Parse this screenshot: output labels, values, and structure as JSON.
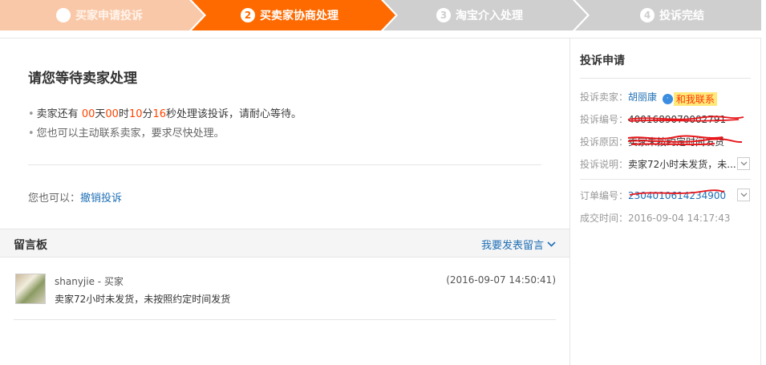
{
  "steps": [
    {
      "num": "",
      "label": "买家申请投诉",
      "state": "done"
    },
    {
      "num": "2",
      "label": "买卖家协商处理",
      "state": "active"
    },
    {
      "num": "3",
      "label": "淘宝介入处理",
      "state": "pending"
    },
    {
      "num": "4",
      "label": "投诉完结",
      "state": "pending"
    }
  ],
  "main": {
    "title": "请您等待卖家处理",
    "countdown": {
      "prefix": "卖家还有 ",
      "days": "00",
      "days_unit": "天",
      "hours": "00",
      "hours_unit": "时",
      "minutes": "10",
      "minutes_unit": "分",
      "seconds": "16",
      "seconds_unit": "秒处理该投诉，请耐心等待。"
    },
    "hint": "您也可以主动联系卖家，要求尽快处理。",
    "also_label": "您也可以：",
    "cancel_link": "撤销投诉"
  },
  "board": {
    "title": "留言板",
    "post_link": "我要发表留言",
    "messages": [
      {
        "user": "shanyjie - 买家",
        "time": "(2016-09-07 14:50:41)",
        "text": "卖家72小时未发货，未按照约定时间发货"
      }
    ]
  },
  "side": {
    "title": "投诉申请",
    "seller_label": "投诉卖家：",
    "seller_name": "胡丽康",
    "contact_tag": "和我联系",
    "number_label": "投诉编号：",
    "number_value": "4001689070002791",
    "reason_label": "投诉原因：",
    "reason_value": "卖家未按约定时间发货",
    "desc_label": "投诉说明：",
    "desc_value": "卖家72小时未发货，未...",
    "order_label": "订单编号：",
    "order_value": "2304010614234900",
    "deal_label": "成交时间：",
    "deal_value": "2016-09-04 14:17:43"
  },
  "colors": {
    "active": "#ff6a00",
    "done": "#f9c8a8",
    "pending": "#cfcfcf",
    "link": "#1f6fb5",
    "highlight": "#ff4400"
  }
}
